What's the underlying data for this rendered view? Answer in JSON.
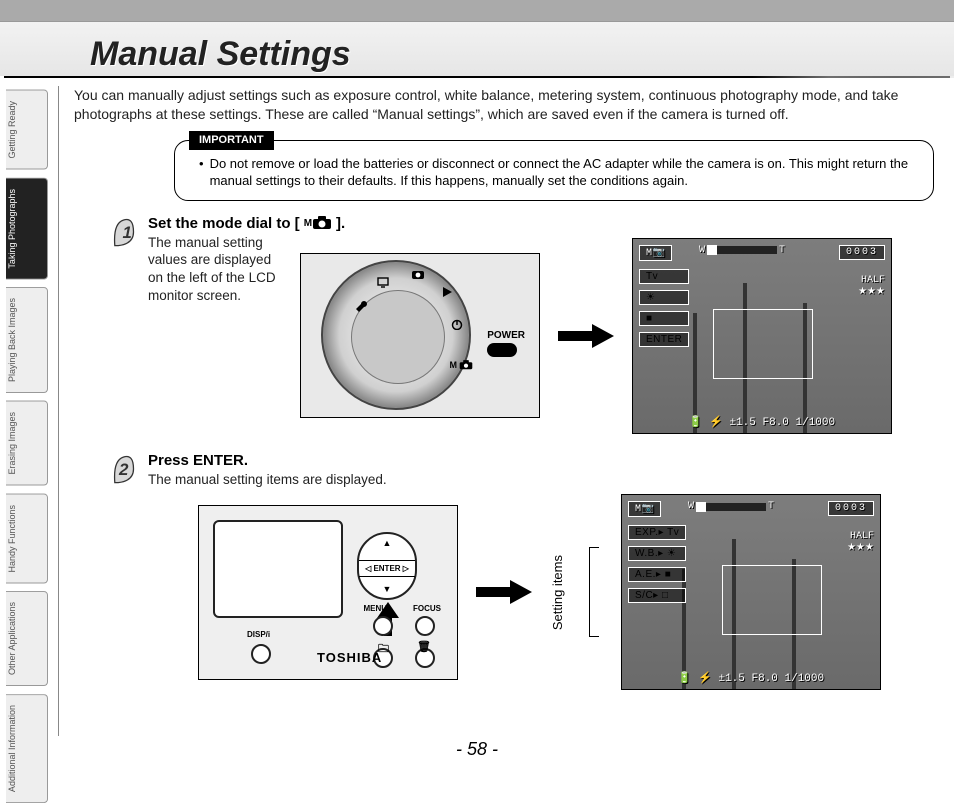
{
  "header": {
    "title": "Manual Settings"
  },
  "tabs": [
    {
      "label": "Getting\nReady",
      "active": false
    },
    {
      "label": "Taking\nPhotographs",
      "active": true
    },
    {
      "label": "Playing\nBack Images",
      "active": false
    },
    {
      "label": "Erasing\nImages",
      "active": false
    },
    {
      "label": "Handy\nFunctions",
      "active": false
    },
    {
      "label": "Other\nApplications",
      "active": false
    },
    {
      "label": "Additional\nInformation",
      "active": false
    }
  ],
  "intro": "You can manually adjust settings such as exposure control, white balance, metering system, continuous photography mode, and take photographs at these settings. These are called “Manual settings”, which are saved even if the camera is turned off.",
  "important": {
    "label": "IMPORTANT",
    "bullet": "Do not remove or load the batteries or disconnect or connect the AC adapter while the camera is on. This might return the manual settings to their defaults. If this happens, manually set the conditions again."
  },
  "step1": {
    "heading_pre": "Set the mode dial to [ ",
    "mode_symbol": "M",
    "heading_post": " ].",
    "desc": "The manual setting values are displayed on the left of the LCD monitor screen.",
    "dial": {
      "power_label": "POWER",
      "mode_mark": "M"
    },
    "lcd": {
      "top_left_mode": "M",
      "top_zoom_w": "W",
      "top_zoom_t": "T",
      "counter": "0003",
      "left_items": [
        "Tv",
        "☀",
        "■",
        "ENTER"
      ],
      "right_half": "HALF",
      "right_stars": "★★★",
      "bottom": "±1.5   F8.0  1/1000"
    }
  },
  "step2": {
    "heading": "Press ENTER.",
    "desc": "The manual setting items are displayed.",
    "back": {
      "enter_label": "ENTER",
      "menu_label": "MENU",
      "focus_label": "FOCUS",
      "disp_label": "DISP/i",
      "brand": "TOSHIBA",
      "folder_icon": "folder-icon",
      "trash_icon": "trash-icon"
    },
    "setting_items_label": "Setting items",
    "lcd": {
      "top_left_mode": "M",
      "top_zoom_w": "W",
      "top_zoom_t": "T",
      "counter": "0003",
      "left_items": [
        "EXP.▸  Tv",
        "W.B.▸  ☀",
        "A.E.▸  ■",
        "S/C▸  □"
      ],
      "right_half": "HALF",
      "right_stars": "★★★",
      "bottom": "±1.5   F8.0  1/1000"
    }
  },
  "page_number": "- 58 -"
}
